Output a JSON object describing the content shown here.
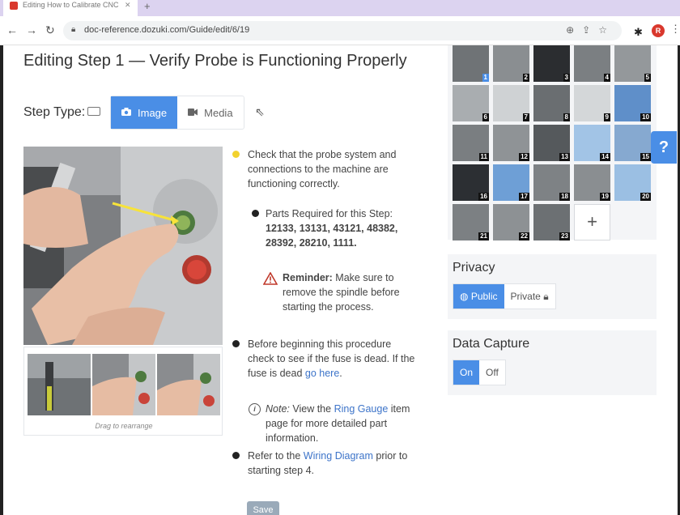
{
  "browser": {
    "tab_title": "Editing How to Calibrate CNC ...",
    "url": "doc-reference.dozuki.com/Guide/edit/6/19",
    "profile_initial": "R"
  },
  "page": {
    "title": "Editing Step 1 — Verify Probe is Functioning Properly"
  },
  "step_type": {
    "label": "Step Type:",
    "options": [
      {
        "label": "Image",
        "active": true,
        "icon": "camera-icon"
      },
      {
        "label": "Media",
        "active": false,
        "icon": "video-icon"
      }
    ]
  },
  "media": {
    "caption": "Drag to rearrange"
  },
  "bullets": {
    "b1": "Check that the probe system and connections to the machine are functioning correctly.",
    "b2_prefix": "Parts Required for this Step: ",
    "b2_parts": "12133, 13131, 43121, 48382, 28392, 28210, 1111.",
    "b3_label": "Reminder:",
    "b3_text": " Make sure to remove the spindle before starting the process.",
    "b4_text": "Before beginning this procedure check to see if the fuse is dead. If the fuse is dead ",
    "b4_link": "go here",
    "b4_end": ".",
    "b5_label": "Note:",
    "b5_pre": " View the ",
    "b5_link": "Ring Gauge",
    "b5_post": " item page for more detailed part information.",
    "b6_pre": "Refer to the ",
    "b6_link": "Wiring Diagram",
    "b6_post": " prior to starting step 4.",
    "colors": {
      "yellow": "#f2d22e",
      "black": "#222222",
      "red": "#c0392b"
    }
  },
  "save_label": "Save",
  "gallery": {
    "numbers": [
      "1",
      "2",
      "3",
      "4",
      "5",
      "6",
      "7",
      "8",
      "9",
      "10",
      "11",
      "12",
      "13",
      "14",
      "15",
      "16",
      "17",
      "18",
      "19",
      "20",
      "21",
      "22",
      "23"
    ],
    "add_label": "+"
  },
  "privacy": {
    "title": "Privacy",
    "public_label": "Public",
    "private_label": "Private"
  },
  "data_capture": {
    "title": "Data Capture",
    "on_label": "On",
    "off_label": "Off"
  },
  "help_label": "?",
  "accent": "#4a8ee6"
}
